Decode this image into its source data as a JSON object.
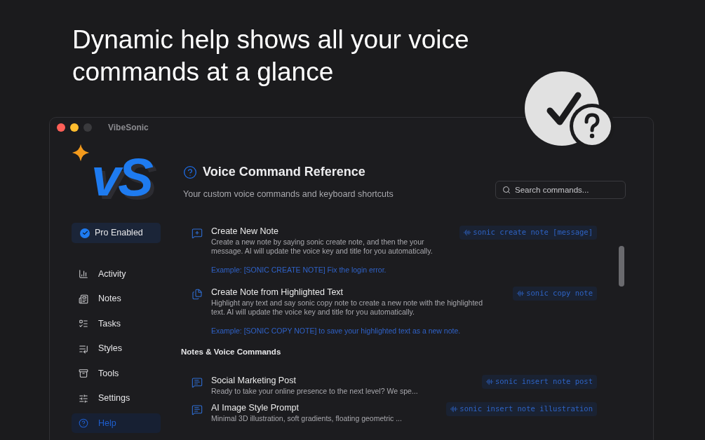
{
  "headline": "Dynamic help shows all your voice commands at a glance",
  "window": {
    "title": "VibeSonic"
  },
  "sidebar": {
    "logo_text": "vS",
    "badge": "Pro Enabled",
    "items": [
      {
        "label": "Activity",
        "kind": "activity",
        "selected": false
      },
      {
        "label": "Notes",
        "kind": "notes",
        "selected": false
      },
      {
        "label": "Tasks",
        "kind": "tasks",
        "selected": false
      },
      {
        "label": "Styles",
        "kind": "styles",
        "selected": false
      },
      {
        "label": "Tools",
        "kind": "tools",
        "selected": false
      },
      {
        "label": "Settings",
        "kind": "settings",
        "selected": false
      },
      {
        "label": "Help",
        "kind": "help",
        "selected": true
      }
    ]
  },
  "header": {
    "title": "Voice Command Reference",
    "subtitle": "Your custom voice commands and keyboard shortcuts",
    "search": {
      "placeholder": "Search commands..."
    }
  },
  "groups": [
    {
      "items": [
        {
          "kind": "create",
          "title": "Create New Note",
          "description": "Create a new note by saying sonic create note, and then the your message. AI will update the voice key and title for you automatically.",
          "example": "Example: [SONIC CREATE NOTE] Fix the login error.",
          "command": "sonic create note [message]"
        },
        {
          "kind": "copy",
          "title": "Create Note from Highlighted Text",
          "description": "Highlight any text and say sonic copy note to create a new note with the highlighted text. AI will update the voice key and title for you automatically.",
          "example": "Example: [SONIC COPY NOTE] to save your highlighted text as a new note.",
          "command": "sonic copy note"
        }
      ]
    },
    {
      "heading": "Notes & Voice Commands",
      "items": [
        {
          "kind": "note",
          "title": "Social Marketing Post",
          "description": "Ready to take your online presence to the next level? We spe...",
          "command": "sonic insert note post"
        },
        {
          "kind": "note",
          "title": "AI Image Style Prompt",
          "description": "Minimal 3D illustration, soft gradients, floating geometric ...",
          "command": "sonic insert note illustration"
        }
      ]
    }
  ]
}
